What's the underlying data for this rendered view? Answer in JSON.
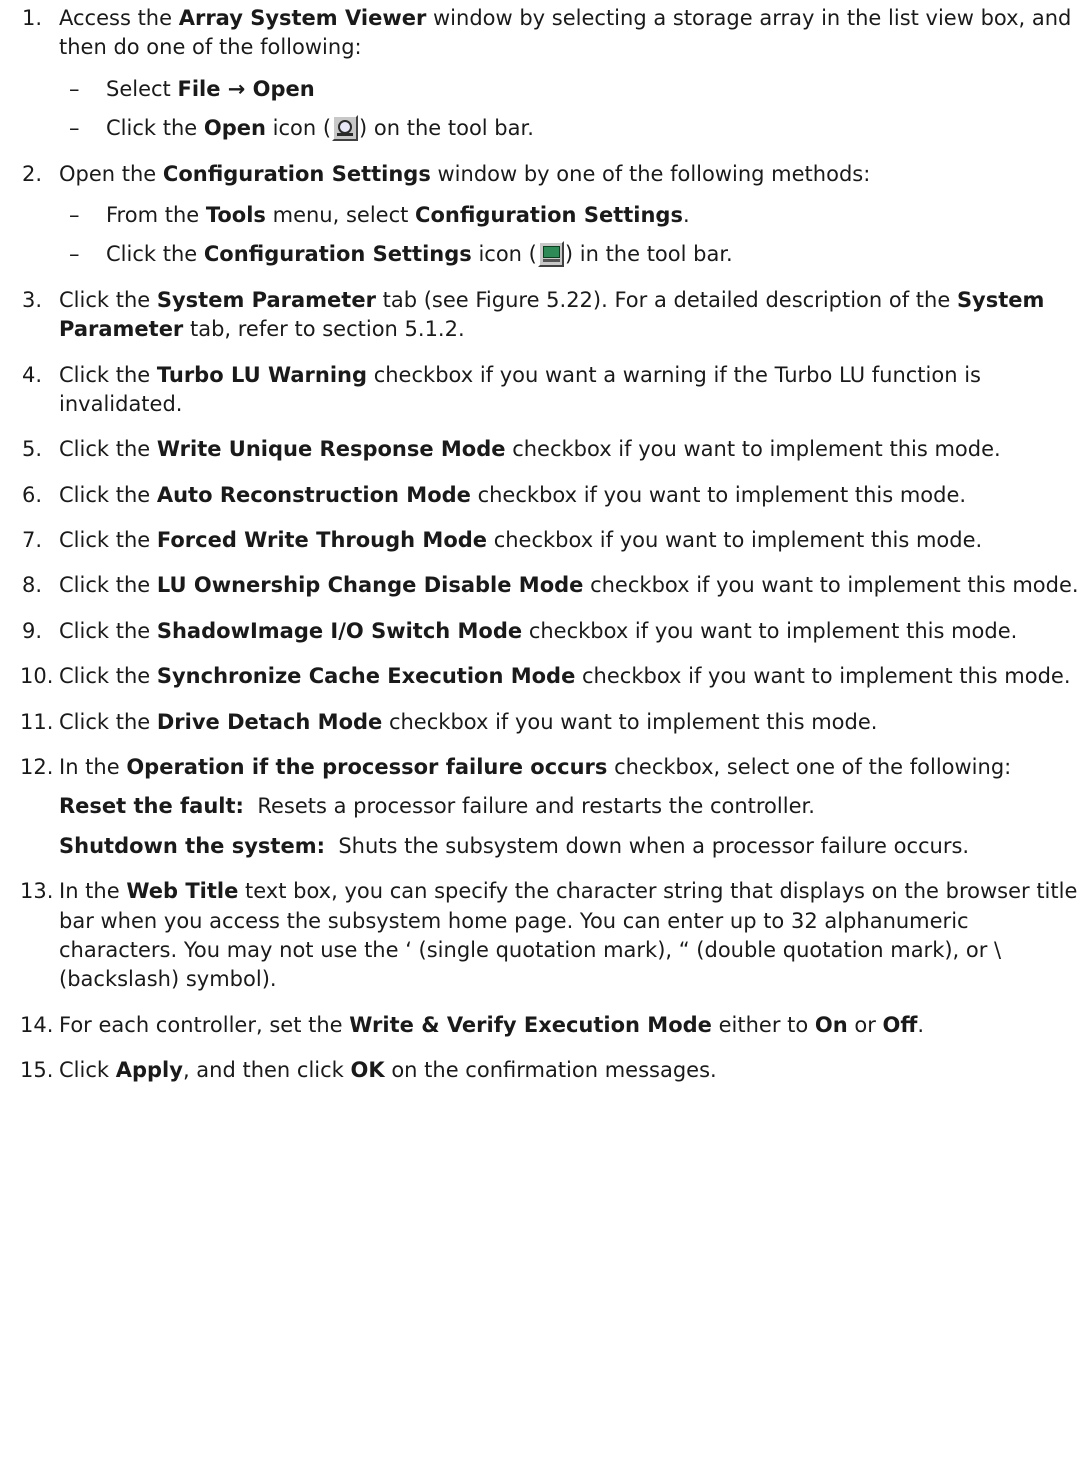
{
  "steps": [
    {
      "num": "1.",
      "parts": [
        {
          "t": "Access the "
        },
        {
          "b": "Array System Viewer"
        },
        {
          "t": " window by selecting a storage array in the list view box, and then do one of the following:"
        }
      ],
      "sub": [
        [
          {
            "t": "Select "
          },
          {
            "b": "File → Open"
          }
        ],
        [
          {
            "t": "Click the "
          },
          {
            "b": "Open"
          },
          {
            "t": " icon ("
          },
          {
            "icon": "open-icon"
          },
          {
            "t": ") on the tool bar."
          }
        ]
      ]
    },
    {
      "num": "2.",
      "parts": [
        {
          "t": "Open the "
        },
        {
          "b": "Configuration Settings"
        },
        {
          "t": " window by one of the following methods:"
        }
      ],
      "sub": [
        [
          {
            "t": "From the "
          },
          {
            "b": "Tools"
          },
          {
            "t": " menu, select "
          },
          {
            "b": "Configuration Settings"
          },
          {
            "t": "."
          }
        ],
        [
          {
            "t": "Click the "
          },
          {
            "b": "Configuration Settings"
          },
          {
            "t": " icon ("
          },
          {
            "icon": "config-icon"
          },
          {
            "t": ") in the tool bar."
          }
        ]
      ]
    },
    {
      "num": "3.",
      "parts": [
        {
          "t": "Click the "
        },
        {
          "b": "System Parameter"
        },
        {
          "t": " tab (see Figure 5.22). For a detailed description of the "
        },
        {
          "b": "System Parameter"
        },
        {
          "t": " tab, refer to section 5.1.2."
        }
      ]
    },
    {
      "num": "4.",
      "parts": [
        {
          "t": "Click the "
        },
        {
          "b": "Turbo LU Warning"
        },
        {
          "t": " checkbox if you want a warning if the Turbo LU function is invalidated."
        }
      ]
    },
    {
      "num": "5.",
      "parts": [
        {
          "t": "Click the "
        },
        {
          "b": "Write Unique Response Mode"
        },
        {
          "t": " checkbox if you want to implement this mode."
        }
      ]
    },
    {
      "num": "6.",
      "parts": [
        {
          "t": "Click the "
        },
        {
          "b": "Auto Reconstruction Mode"
        },
        {
          "t": " checkbox if you want to implement this mode."
        }
      ]
    },
    {
      "num": "7.",
      "parts": [
        {
          "t": "Click the "
        },
        {
          "b": "Forced Write Through Mode"
        },
        {
          "t": " checkbox if you want to implement this mode."
        }
      ]
    },
    {
      "num": "8.",
      "parts": [
        {
          "t": "Click the "
        },
        {
          "b": "LU Ownership Change Disable Mode"
        },
        {
          "t": " checkbox if you want to implement this mode."
        }
      ]
    },
    {
      "num": "9.",
      "parts": [
        {
          "t": "Click the "
        },
        {
          "b": "ShadowImage I/O Switch Mode"
        },
        {
          "t": " checkbox if you want to implement this mode."
        }
      ]
    },
    {
      "num": "10.",
      "parts": [
        {
          "t": "Click the "
        },
        {
          "b": "Synchronize Cache Execution Mode"
        },
        {
          "t": " checkbox if you want to implement this mode."
        }
      ]
    },
    {
      "num": "11.",
      "parts": [
        {
          "t": "Click the "
        },
        {
          "b": "Drive Detach Mode"
        },
        {
          "t": " checkbox if you want to implement this mode."
        }
      ]
    },
    {
      "num": "12.",
      "parts": [
        {
          "t": "In the "
        },
        {
          "b": "Operation if the processor failure occurs"
        },
        {
          "t": " checkbox, select one of the following:"
        }
      ],
      "defs": [
        {
          "term": "Reset the fault:",
          "desc": "Resets a processor failure and restarts the controller."
        },
        {
          "term": "Shutdown the system:",
          "desc": "Shuts the subsystem down when a processor failure occurs."
        }
      ]
    },
    {
      "num": "13.",
      "parts": [
        {
          "t": "In the "
        },
        {
          "b": "Web Title"
        },
        {
          "t": " text box, you can specify the character string that displays on the browser title bar when you access the subsystem home page. You can enter up to 32 alphanumeric characters. You may not use the ‘ (single quotation mark), “ (double quotation mark), or \\ (backslash) symbol)."
        }
      ]
    },
    {
      "num": "14.",
      "parts": [
        {
          "t": "For each controller, set the "
        },
        {
          "b": "Write & Verify Execution Mode"
        },
        {
          "t": " either to "
        },
        {
          "b": "On"
        },
        {
          "t": " or "
        },
        {
          "b": "Off"
        },
        {
          "t": "."
        }
      ]
    },
    {
      "num": "15.",
      "parts": [
        {
          "t": "Click "
        },
        {
          "b": "Apply"
        },
        {
          "t": ", and then click "
        },
        {
          "b": "OK"
        },
        {
          "t": " on the confirmation messages."
        }
      ]
    }
  ]
}
